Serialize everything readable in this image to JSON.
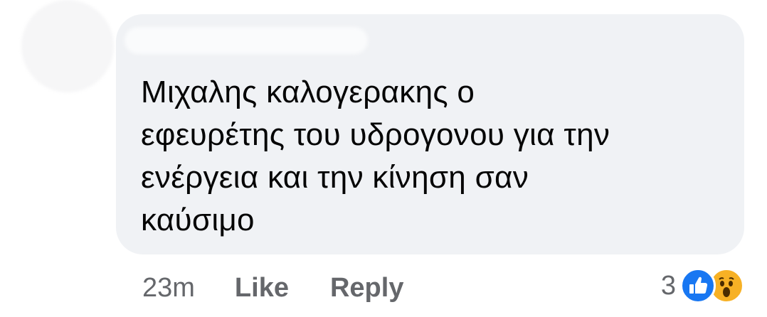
{
  "comment": {
    "text": "Μιχαλης καλογερακης ο\nεφευρέτης του υδρογονου για την\nενέργεια και την κίνηση σαν\nκαύσιμο"
  },
  "actions": {
    "time": "23m",
    "like_label": "Like",
    "reply_label": "Reply"
  },
  "reactions": {
    "count": "3",
    "icons": [
      "like-icon",
      "wow-icon"
    ]
  },
  "colors": {
    "bubble": "#f0f2f5",
    "meta_text": "#65676b",
    "like_blue": "#1877f2",
    "wow_yellow": "#f7b125"
  }
}
